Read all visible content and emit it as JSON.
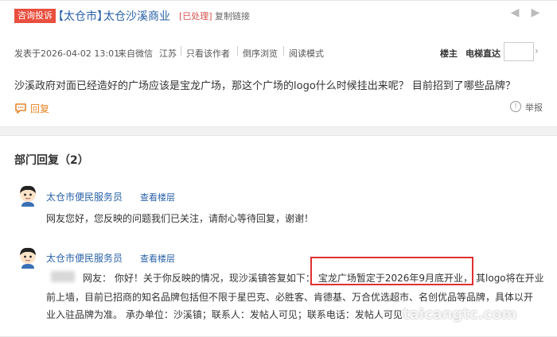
{
  "header": {
    "tag": "咨询投诉",
    "forum": "【太仓市】",
    "title": "太仓沙溪商业",
    "status": "[已处理]",
    "copy_link": "复制链接"
  },
  "meta": {
    "posted": "发表于2026-04-02 13:01",
    "source": "来自微信",
    "location": "江苏",
    "only_author": "只看该作者",
    "reverse": "倒序浏览",
    "reading_mode": "阅读模式",
    "floor_owner": "楼主",
    "elevator": "电梯直达",
    "floor_input_value": ""
  },
  "post": {
    "question": "沙溪政府对面已经造好的广场应该是宝龙广场，那这个广场的logo什么时候挂出来呢？ 目前招到了哪些品牌？",
    "reply_label": "回复",
    "report_label": "举报"
  },
  "department": {
    "title": "部门回复（2）",
    "replies": [
      {
        "author": "太仓市便民服务员",
        "view_floor": "查看楼层",
        "text": "网友您好，您反映的问题我们已关注，请耐心等待回复，谢谢！"
      },
      {
        "author": "太仓市便民服务员",
        "view_floor": "查看楼层",
        "line1_prefix": "网友：  你好！关于你反映的情况，现沙溪镇答复如下：",
        "line1_highlight": "宝龙广场暂定于2026年9月底开业，",
        "line1_suffix": "其logo将在开业",
        "line2": "前上墙，目前已招商的知名品牌包括但不限于星巴克、必胜客、肯德基、万合优选超市、名创优品等品牌，具体以开",
        "line3": "业入驻品牌为准。 承办单位：沙溪镇；联系人：发帖人可见；联系电话：发帖人可见"
      }
    ]
  },
  "watermark": "taicangtc.com",
  "colors": {
    "link_blue": "#2a62a8",
    "tag_red": "#e94f3e",
    "reply_orange": "#e8852a",
    "highlight_red": "#e03030"
  }
}
